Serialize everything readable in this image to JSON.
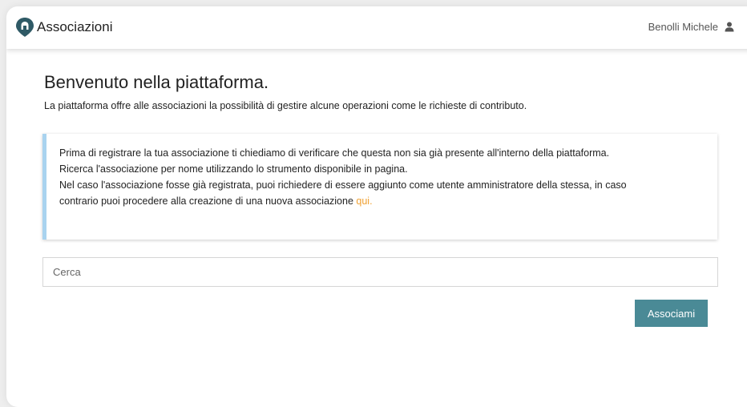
{
  "navbar": {
    "brand_title": "Associazioni",
    "logo_icon": "map-pin-logo-icon",
    "user_name": "Benolli Michele",
    "user_icon": "user-icon"
  },
  "main": {
    "title": "Benvenuto nella piattaforma.",
    "intro": "La piattaforma offre alle associazioni la possibilità di gestire alcune operazioni come le richieste di contributo.",
    "info": {
      "line1": "Prima di registrare la tua associazione ti chiediamo di verificare che questa non sia già presente all'interno della piattaforma.",
      "line2": "Ricerca l'associazione per nome utilizzando lo strumento disponibile in pagina.",
      "line3": "Nel caso l'associazione fosse già registrata, puoi richiedere di essere aggiunto come utente amministratore della stessa, in caso",
      "line4": "contrario puoi procedere alla creazione di una nuova associazione",
      "link": "qui."
    },
    "search": {
      "placeholder": "Cerca",
      "value": ""
    },
    "button_label": "Associami"
  },
  "colors": {
    "accent_link": "#f0a030",
    "button_bg": "#4a8a96",
    "info_border": "#a9d3ef",
    "logo": "#2f5a66"
  }
}
